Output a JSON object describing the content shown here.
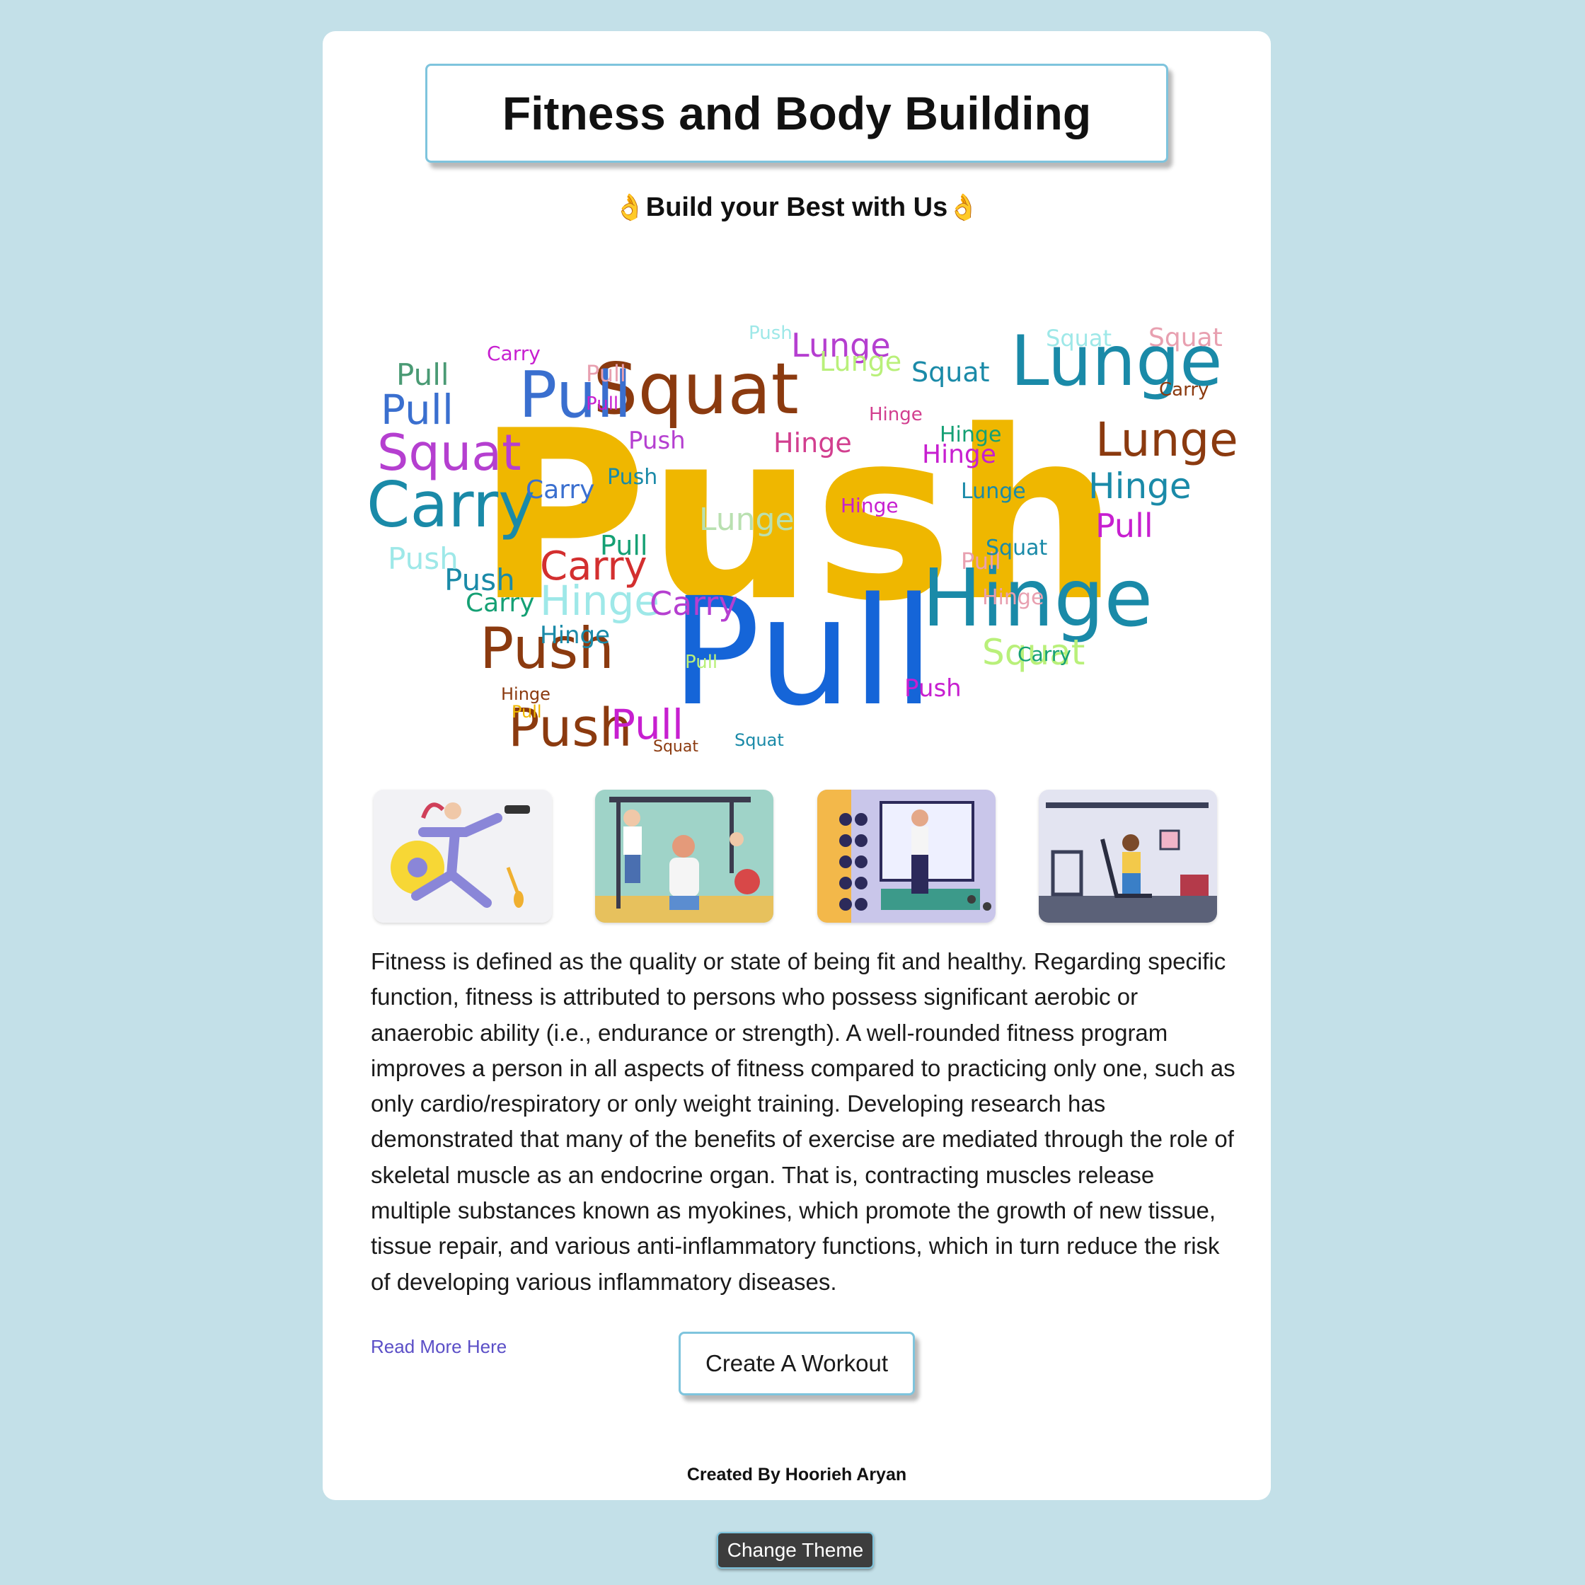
{
  "header": {
    "title": "Fitness and Body Building",
    "tagline": "Build your Best with Us",
    "tagline_emoji": "👌"
  },
  "word_cloud": {
    "words": [
      "Push",
      "Pull",
      "Squat",
      "Lunge",
      "Hinge",
      "Carry"
    ],
    "colors": [
      "#efb700",
      "#1565d8",
      "#8b3a0f",
      "#1a8aa8",
      "#c71fd0",
      "#b9f07a",
      "#e8a0b0",
      "#9ee8e8",
      "#d32f2f",
      "#15a074"
    ]
  },
  "gallery": [
    {
      "label": "woman-lunging-with-dumbbells-illustration"
    },
    {
      "label": "gym-pullup-and-dumbbell-illustration"
    },
    {
      "label": "man-lifting-dumbbells-illustration"
    },
    {
      "label": "woman-on-elliptical-illustration"
    }
  ],
  "description": "Fitness is defined as the quality or state of being fit and healthy. Regarding specific function, fitness is attributed to persons who possess significant aerobic or anaerobic ability (i.e., endurance or strength). A well-rounded fitness program improves a person in all aspects of fitness compared to practicing only one, such as only cardio/respiratory or only weight training. Developing research has demonstrated that many of the benefits of exercise are mediated through the role of skeletal muscle as an endocrine organ. That is, contracting muscles release multiple substances known as myokines, which promote the growth of new tissue, tissue repair, and various anti-inflammatory functions, which in turn reduce the risk of developing various inflammatory diseases.",
  "read_more": "Read More Here",
  "workout_button": "Create A Workout",
  "credit": "Created By Hoorieh Aryan",
  "theme_button": "Change Theme"
}
